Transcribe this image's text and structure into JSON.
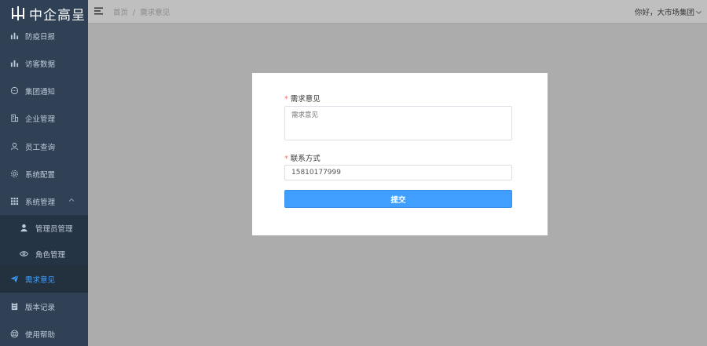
{
  "app": {
    "logo_text": "中企高呈"
  },
  "sidebar": {
    "items": [
      {
        "label": "防疫日报",
        "icon": "bar-chart-icon"
      },
      {
        "label": "访客数据",
        "icon": "bar-chart-icon"
      },
      {
        "label": "集团通知",
        "icon": "chat-bubble-icon"
      },
      {
        "label": "企业管理",
        "icon": "building-icon"
      },
      {
        "label": "员工查询",
        "icon": "user-icon"
      },
      {
        "label": "系统配置",
        "icon": "gear-icon"
      },
      {
        "label": "系统管理",
        "icon": "grid-icon",
        "expanded": true
      },
      {
        "label": "管理员管理",
        "icon": "person-icon",
        "sub": true
      },
      {
        "label": "角色管理",
        "icon": "eye-icon",
        "sub": true
      },
      {
        "label": "需求意见",
        "icon": "paper-plane-icon",
        "active": true
      },
      {
        "label": "版本记录",
        "icon": "clipboard-icon"
      },
      {
        "label": "使用帮助",
        "icon": "help-circle-icon"
      }
    ]
  },
  "header": {
    "breadcrumb": [
      "首页",
      "需求意见"
    ],
    "breadcrumb_sep": "/",
    "user_greeting": "你好，大市场集团"
  },
  "form": {
    "feedback_label": "需求意见",
    "feedback_placeholder": "需求意见",
    "contact_label": "联系方式",
    "contact_value": "15810177999",
    "required_mark": "*",
    "submit_label": "提交"
  },
  "colors": {
    "sidebar_bg": "#304156",
    "active_text": "#409eff",
    "primary": "#409eff",
    "required": "#f56c6c"
  }
}
